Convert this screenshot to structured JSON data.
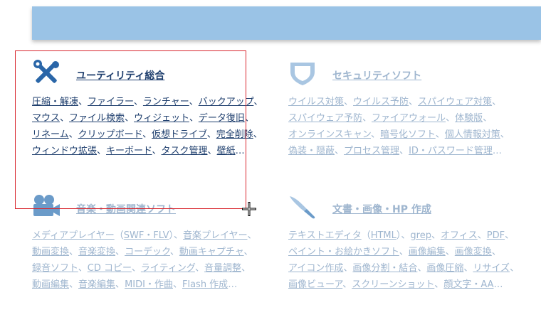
{
  "colors": {
    "banner": "#9ac3e6",
    "active_text": "#1f3f6e",
    "faded_text": "#9fb6cf",
    "selection": "#d9262e"
  },
  "categories": [
    {
      "icon": "tools-icon",
      "title": "ユーティリティ総合",
      "lines": [
        [
          "圧縮・解凍",
          "ファイラー",
          "ランチャー",
          "バックアップ"
        ],
        [
          "マウス",
          "ファイル検索",
          "ウィジェット",
          "データ復旧"
        ],
        [
          "リネーム",
          "クリップボード",
          "仮想ドライブ",
          "完全削除"
        ],
        [
          "ウィンドウ拡張",
          "キーボード",
          "タスク管理",
          "壁紙"
        ]
      ]
    },
    {
      "icon": "shield-icon",
      "title": "セキュリティソフト",
      "lines": [
        [
          "ウイルス対策",
          "ウイルス予防",
          "スパイウェア対策"
        ],
        [
          "スパイウェア予防",
          "ファイアウォール",
          "体験版"
        ],
        [
          "オンラインスキャン",
          "暗号化ソフト",
          "個人情報対策"
        ],
        [
          "偽装・隠蔽",
          "プロセス管理",
          "ID・パスワード管理"
        ]
      ]
    },
    {
      "icon": "video-camera-icon",
      "title": "音楽・動画関連ソフト",
      "lines": [
        [
          "メディアプレイヤー（",
          "SWF・FLV",
          "）、",
          "音楽プレイヤー"
        ],
        [
          "動画変換",
          "音楽変換",
          "コーデック",
          "動画キャプチャ"
        ],
        [
          "録音ソフト",
          "CD コピー",
          "ライティング",
          "音量調整"
        ],
        [
          "動画編集",
          "音楽編集",
          "MIDI・作曲",
          "Flash 作成"
        ]
      ]
    },
    {
      "icon": "paint-brush-icon",
      "title": "文書・画像・HP 作成",
      "lines": [
        [
          "テキストエディタ（",
          "HTML",
          "）、",
          "grep",
          "オフィス",
          "PDF"
        ],
        [
          "ペイント・お絵かきソフト",
          "画像編集",
          "画像変換"
        ],
        [
          "アイコン作成",
          "画像分割・結合",
          "画像圧縮",
          "リサイズ"
        ],
        [
          "画像ビューア",
          "スクリーンショット",
          "顔文字・AA"
        ]
      ]
    }
  ]
}
